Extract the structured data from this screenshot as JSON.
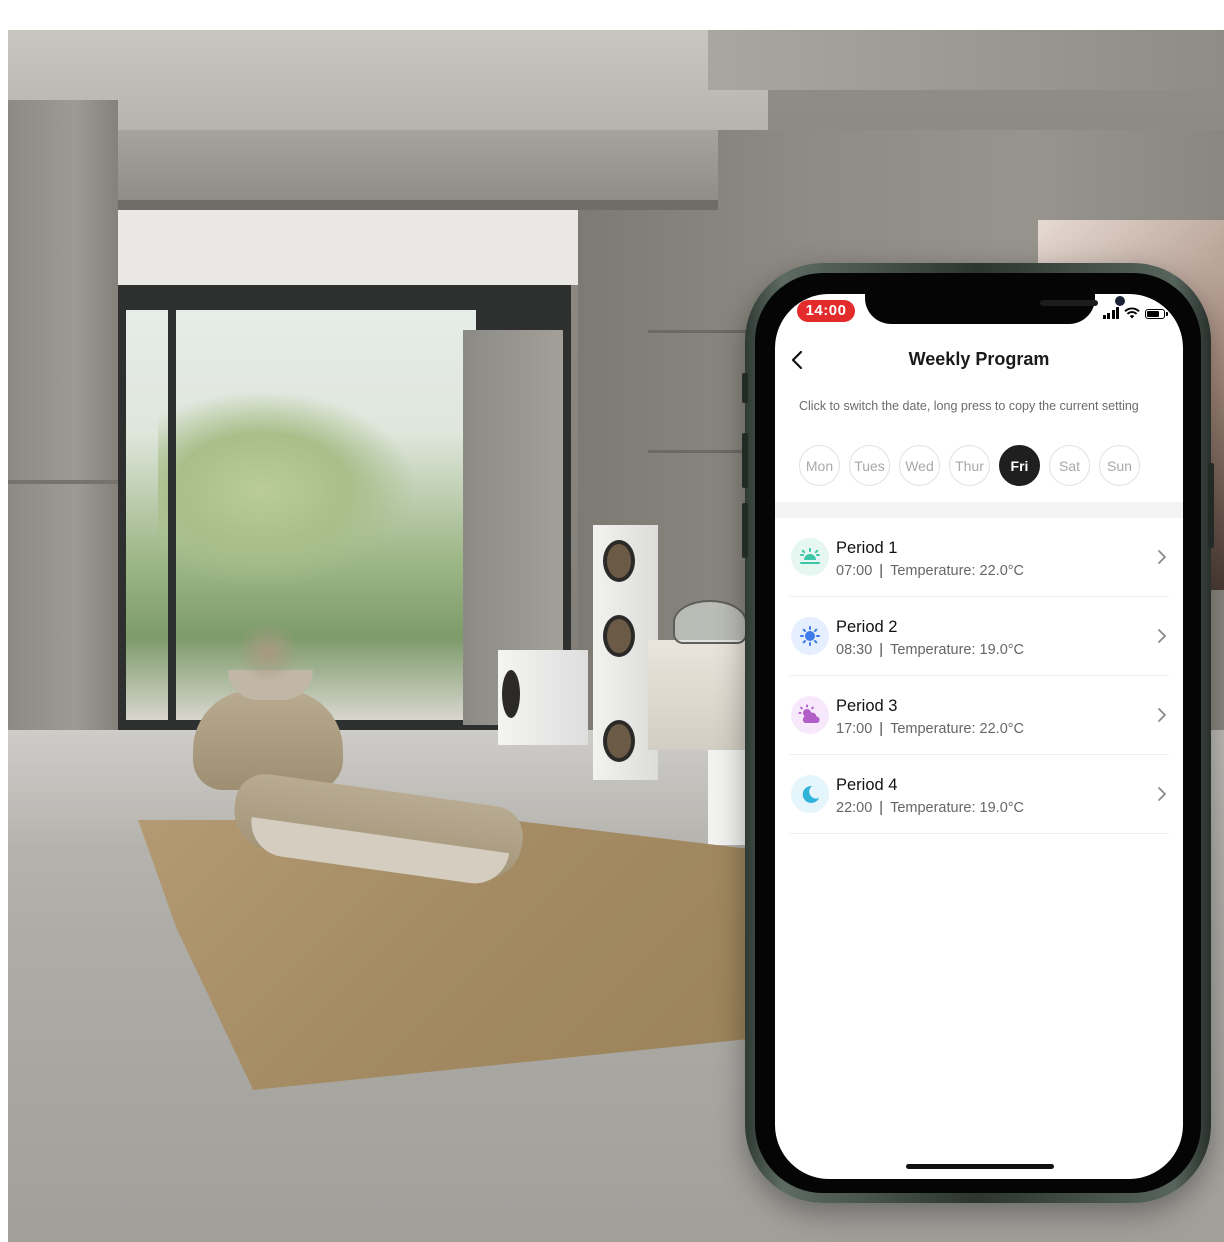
{
  "status_bar": {
    "time": "14:00",
    "battery_level": 0.8
  },
  "header": {
    "title": "Weekly Program"
  },
  "hint": "Click to switch the date, long press to copy the current setting",
  "days": [
    {
      "label": "Mon",
      "active": false
    },
    {
      "label": "Tues",
      "active": false
    },
    {
      "label": "Wed",
      "active": false
    },
    {
      "label": "Thur",
      "active": false
    },
    {
      "label": "Fri",
      "active": true
    },
    {
      "label": "Sat",
      "active": false
    },
    {
      "label": "Sun",
      "active": false
    }
  ],
  "periods": [
    {
      "name": "Period 1",
      "time": "07:00",
      "separator": "|",
      "temperature": "Temperature: 22.0°C",
      "icon": "sunrise-icon",
      "icon_color": "#3cc6a8",
      "icon_bg": "#e6f7f1"
    },
    {
      "name": "Period 2",
      "time": "08:30",
      "separator": "|",
      "temperature": "Temperature: 19.0°C",
      "icon": "sun-icon",
      "icon_color": "#3d7bea",
      "icon_bg": "#e6efff"
    },
    {
      "name": "Period 3",
      "time": "17:00",
      "separator": "|",
      "temperature": "Temperature: 22.0°C",
      "icon": "sunset-cloud-icon",
      "icon_color": "#b25ec9",
      "icon_bg": "#f7e8fb"
    },
    {
      "name": "Period 4",
      "time": "22:00",
      "separator": "|",
      "temperature": "Temperature: 19.0°C",
      "icon": "moon-icon",
      "icon_color": "#2fb3d8",
      "icon_bg": "#e4f5fb"
    }
  ],
  "colors": {
    "status_time_bg": "#e32b2b",
    "active_day_bg": "#1f1f1f"
  }
}
